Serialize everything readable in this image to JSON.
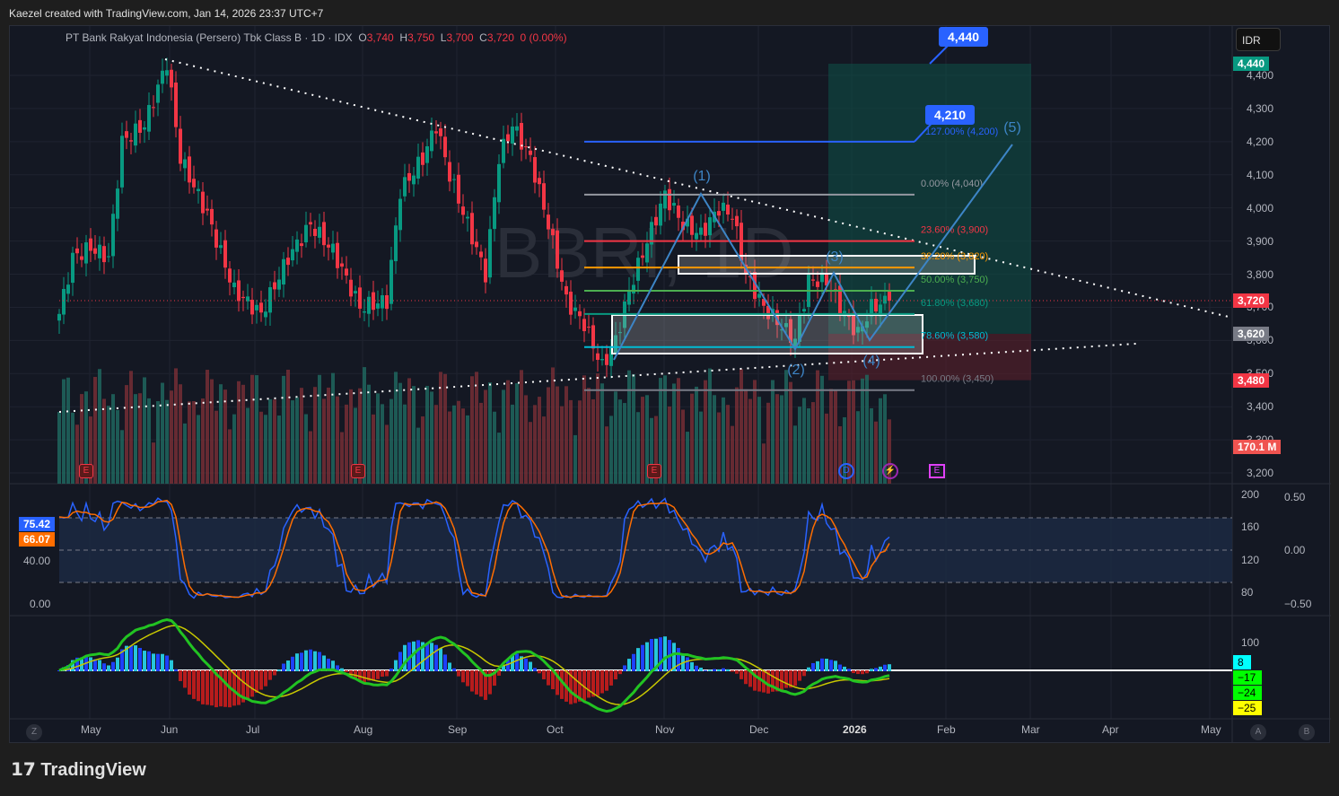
{
  "credit": "Kaezel created with TradingView.com, Jan 14, 2026 23:37 UTC+7",
  "legend": {
    "name": "PT Bank Rakyat Indonesia (Persero) Tbk Class B · 1D · IDX",
    "o_label": "O",
    "o": "3,740",
    "h_label": "H",
    "h": "3,750",
    "l_label": "L",
    "l": "3,700",
    "c_label": "C",
    "c": "3,720",
    "change": "0 (0.00%)"
  },
  "watermark": "BBRI, 1D",
  "currency": "IDR",
  "price_axis": [
    "4,400",
    "4,300",
    "4,200",
    "4,100",
    "4,000",
    "3,900",
    "3,800",
    "3,700",
    "3,600",
    "3,500",
    "3,400",
    "3,300",
    "3,200"
  ],
  "price_tags": {
    "target": "4,440",
    "last": "3,720",
    "entry": "3,620",
    "stop": "3,480",
    "volume": "170.1 M"
  },
  "callouts": {
    "target": "4,440",
    "projection": "4,210"
  },
  "fib": [
    {
      "label": "0.00% (4,040)",
      "price": 4040,
      "color": "#9598a1"
    },
    {
      "label": "23.60% (3,900)",
      "price": 3900,
      "color": "#f23645"
    },
    {
      "label": "38.20% (3,820)",
      "price": 3820,
      "color": "#ff9800"
    },
    {
      "label": "50.00% (3,750)",
      "price": 3750,
      "color": "#4caf50"
    },
    {
      "label": "61.80% (3,680)",
      "price": 3680,
      "color": "#089981"
    },
    {
      "label": "78.60% (3,580)",
      "price": 3580,
      "color": "#00bcd4"
    },
    {
      "label": "100.00% (3,450)",
      "price": 3450,
      "color": "#787b86"
    },
    {
      "label": "127.00% (4,200)",
      "price": 4200,
      "color": "#2962ff"
    }
  ],
  "waves": [
    "(1)",
    "(2)",
    "(3)",
    "(4)",
    "(5)"
  ],
  "events": {
    "earnings": "E",
    "dividend": "D",
    "flash": "⚡"
  },
  "stoch": {
    "k": "75.42",
    "d": "66.07",
    "axis_left": [
      "40.00",
      "0.00"
    ],
    "axis_right": [
      "200",
      "160",
      "120",
      "80"
    ],
    "axis_right2": [
      "0.50",
      "0.00",
      "−0.50"
    ]
  },
  "macd": {
    "axis": [
      "100"
    ],
    "tags": [
      "8",
      "−17",
      "−24",
      "−25"
    ]
  },
  "time_axis": [
    "May",
    "Jun",
    "Jul",
    "Aug",
    "Sep",
    "Oct",
    "Nov",
    "Dec",
    "2026",
    "Feb",
    "Mar",
    "Apr",
    "May"
  ],
  "corner_buttons": {
    "z": "Z",
    "a": "A",
    "b": "B"
  },
  "brand": "TradingView",
  "chart_data": {
    "type": "candlestick",
    "title": "PT Bank Rakyat Indonesia (Persero) Tbk Class B · 1D · IDX",
    "ylim": [
      3180,
      4480
    ],
    "close_path": [
      [
        0,
        3680
      ],
      [
        3,
        3850
      ],
      [
        7,
        3880
      ],
      [
        11,
        3850
      ],
      [
        14,
        4200
      ],
      [
        19,
        4250
      ],
      [
        24,
        4440
      ],
      [
        27,
        4150
      ],
      [
        33,
        3980
      ],
      [
        39,
        3750
      ],
      [
        45,
        3680
      ],
      [
        51,
        3850
      ],
      [
        56,
        3950
      ],
      [
        61,
        3870
      ],
      [
        67,
        3700
      ],
      [
        73,
        3720
      ],
      [
        76,
        4050
      ],
      [
        81,
        4150
      ],
      [
        84,
        4250
      ],
      [
        87,
        4100
      ],
      [
        91,
        3950
      ],
      [
        95,
        3800
      ],
      [
        98,
        4150
      ],
      [
        101,
        4250
      ],
      [
        105,
        4150
      ],
      [
        109,
        3950
      ],
      [
        113,
        3720
      ],
      [
        117,
        3650
      ],
      [
        121,
        3520
      ],
      [
        124,
        3600
      ],
      [
        127,
        3750
      ],
      [
        131,
        3900
      ],
      [
        135,
        4040
      ],
      [
        139,
        3950
      ],
      [
        143,
        3920
      ],
      [
        147,
        4000
      ],
      [
        150,
        3980
      ],
      [
        153,
        3800
      ],
      [
        157,
        3700
      ],
      [
        164,
        3600
      ],
      [
        167,
        3780
      ],
      [
        171,
        3780
      ],
      [
        175,
        3680
      ],
      [
        178,
        3620
      ],
      [
        181,
        3700
      ],
      [
        185,
        3720
      ]
    ]
  }
}
